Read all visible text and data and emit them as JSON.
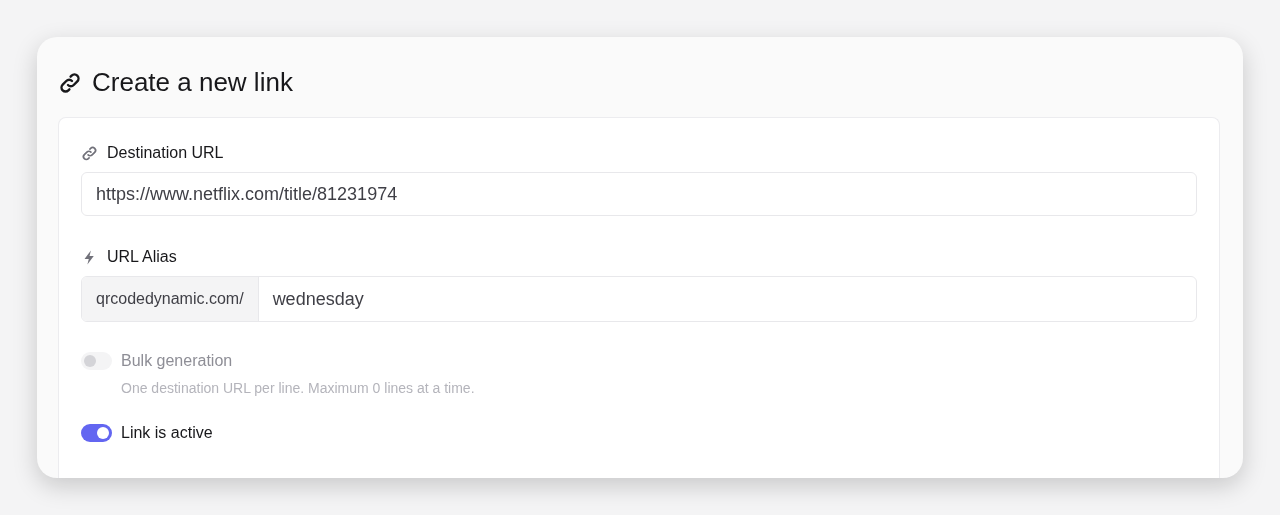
{
  "title": "Create a new link",
  "destination": {
    "label": "Destination URL",
    "value": "https://www.netflix.com/title/81231974"
  },
  "alias": {
    "label": "URL Alias",
    "prefix": "qrcodedynamic.com/",
    "value": "wednesday"
  },
  "toggles": [
    {
      "label": "Bulk generation",
      "on": false,
      "disabled": true,
      "hint": "One destination URL per line. Maximum 0 lines at a time."
    },
    {
      "label": "Link is active",
      "on": true,
      "disabled": false
    }
  ]
}
